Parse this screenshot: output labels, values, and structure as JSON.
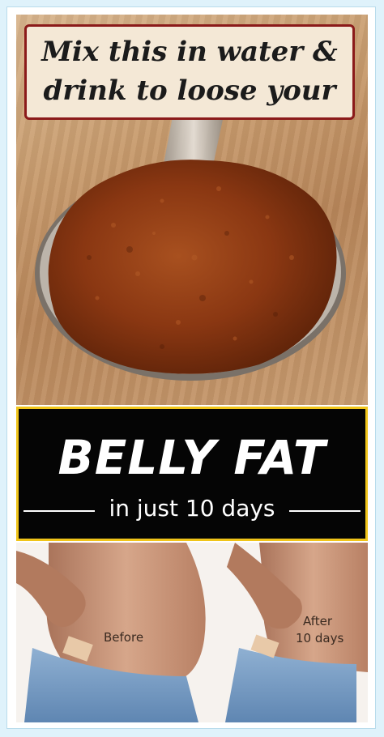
{
  "headline": {
    "line1": "Mix this in water &",
    "line2": "drink to loose your"
  },
  "banner": {
    "title": "BELLY FAT",
    "subtitle": "in just 10 days"
  },
  "comparison": {
    "before_label": "Before",
    "after_label_line1": "After",
    "after_label_line2": "10 days"
  },
  "colors": {
    "page_background": "#dff2fb",
    "title_border": "#8b1a1a",
    "banner_border": "#f0c419",
    "banner_background": "#050505",
    "powder": "#8a3712"
  }
}
